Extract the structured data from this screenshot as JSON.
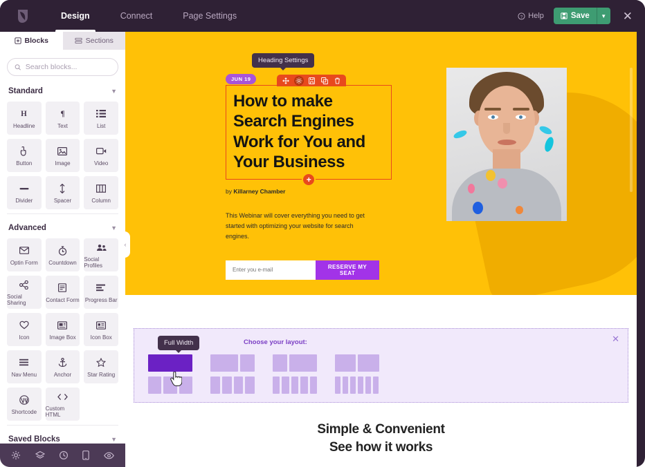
{
  "topbar": {
    "logo_name": "leaf-logo",
    "nav": [
      {
        "label": "Design",
        "active": true
      },
      {
        "label": "Connect",
        "active": false
      },
      {
        "label": "Page Settings",
        "active": false
      }
    ],
    "help_label": "Help",
    "save_label": "Save",
    "close_label": "✕",
    "save_color": "#3e9c72",
    "bar_color": "#2f2135"
  },
  "sidebar": {
    "tabs": [
      {
        "label": "Blocks",
        "active": true
      },
      {
        "label": "Sections",
        "active": false
      }
    ],
    "search": {
      "placeholder": "Search blocks...",
      "value": ""
    },
    "groups": [
      {
        "title": "Standard",
        "blocks": [
          {
            "label": "Headline",
            "icon": "headline-icon"
          },
          {
            "label": "Text",
            "icon": "paragraph-icon"
          },
          {
            "label": "List",
            "icon": "list-icon"
          },
          {
            "label": "Button",
            "icon": "button-click-icon"
          },
          {
            "label": "Image",
            "icon": "image-icon"
          },
          {
            "label": "Video",
            "icon": "video-icon"
          },
          {
            "label": "Divider",
            "icon": "divider-icon"
          },
          {
            "label": "Spacer",
            "icon": "spacer-icon"
          },
          {
            "label": "Column",
            "icon": "column-icon"
          }
        ]
      },
      {
        "title": "Advanced",
        "blocks": [
          {
            "label": "Optin Form",
            "icon": "envelope-icon"
          },
          {
            "label": "Countdown",
            "icon": "stopwatch-icon"
          },
          {
            "label": "Social Profiles",
            "icon": "people-icon"
          },
          {
            "label": "Social Sharing",
            "icon": "share-icon"
          },
          {
            "label": "Contact Form",
            "icon": "form-icon"
          },
          {
            "label": "Progress Bar",
            "icon": "progress-bar-icon"
          },
          {
            "label": "Icon",
            "icon": "heart-icon"
          },
          {
            "label": "Image Box",
            "icon": "image-box-icon"
          },
          {
            "label": "Icon Box",
            "icon": "icon-box-icon"
          },
          {
            "label": "Nav Menu",
            "icon": "hamburger-icon"
          },
          {
            "label": "Anchor",
            "icon": "anchor-icon"
          },
          {
            "label": "Star Rating",
            "icon": "star-icon"
          },
          {
            "label": "Shortcode",
            "icon": "wordpress-icon"
          },
          {
            "label": "Custom HTML",
            "icon": "code-icon"
          }
        ]
      },
      {
        "title": "Saved Blocks",
        "blocks": []
      }
    ],
    "footer_icons": [
      "gear-icon",
      "layers-icon",
      "history-icon",
      "device-preview-icon",
      "eye-preview-icon"
    ],
    "collapse_label": "‹"
  },
  "canvas": {
    "hero": {
      "bg_color": "#ffc107",
      "date_badge": "JUN 19",
      "heading_tooltip": "Heading Settings",
      "element_toolbar": [
        {
          "icon": "move-icon",
          "active": false
        },
        {
          "icon": "gear-icon",
          "active": true
        },
        {
          "icon": "save-block-icon",
          "active": false
        },
        {
          "icon": "duplicate-icon",
          "active": false
        },
        {
          "icon": "trash-icon",
          "active": false
        }
      ],
      "headline": "How to make Search Engines Work for You and Your Business",
      "add_block_label": "+",
      "byline_prefix": "by ",
      "byline_author": "Killarney Chamber",
      "description": "This Webinar will cover everything you need to get started with optimizing your website for search engines.",
      "optin": {
        "placeholder": "Enter you e-mail",
        "value": "",
        "button_label": "RESERVE MY SEAT",
        "button_color": "#a233e8"
      },
      "photo_alt": "portrait-photo-with-confetti"
    },
    "layout_picker": {
      "title": "Choose your layout:",
      "tooltip": "Full Width",
      "close_label": "✕",
      "accent_color": "#6b21c4",
      "options": [
        {
          "name": "full-width",
          "segments": [
            64
          ],
          "selected": true
        },
        {
          "name": "two-thirds-one-third",
          "segments": [
            40,
            21
          ],
          "selected": false
        },
        {
          "name": "one-third-two-thirds",
          "segments": [
            21,
            40
          ],
          "selected": false
        },
        {
          "name": "half-half",
          "segments": [
            30,
            31
          ],
          "selected": false
        },
        {
          "name": "three-equal",
          "segments": [
            20,
            20,
            20
          ],
          "selected": false
        },
        {
          "name": "four-equal",
          "segments": [
            14,
            14,
            14,
            14
          ],
          "selected": false
        },
        {
          "name": "five-equal",
          "segments": [
            11,
            11,
            11,
            11,
            11
          ],
          "selected": false
        },
        {
          "name": "six-equal",
          "segments": [
            8,
            8,
            8,
            8,
            8,
            8
          ],
          "selected": false
        }
      ]
    },
    "bottom_section": {
      "line1": "Simple & Convenient",
      "line2": "See how it works"
    }
  }
}
